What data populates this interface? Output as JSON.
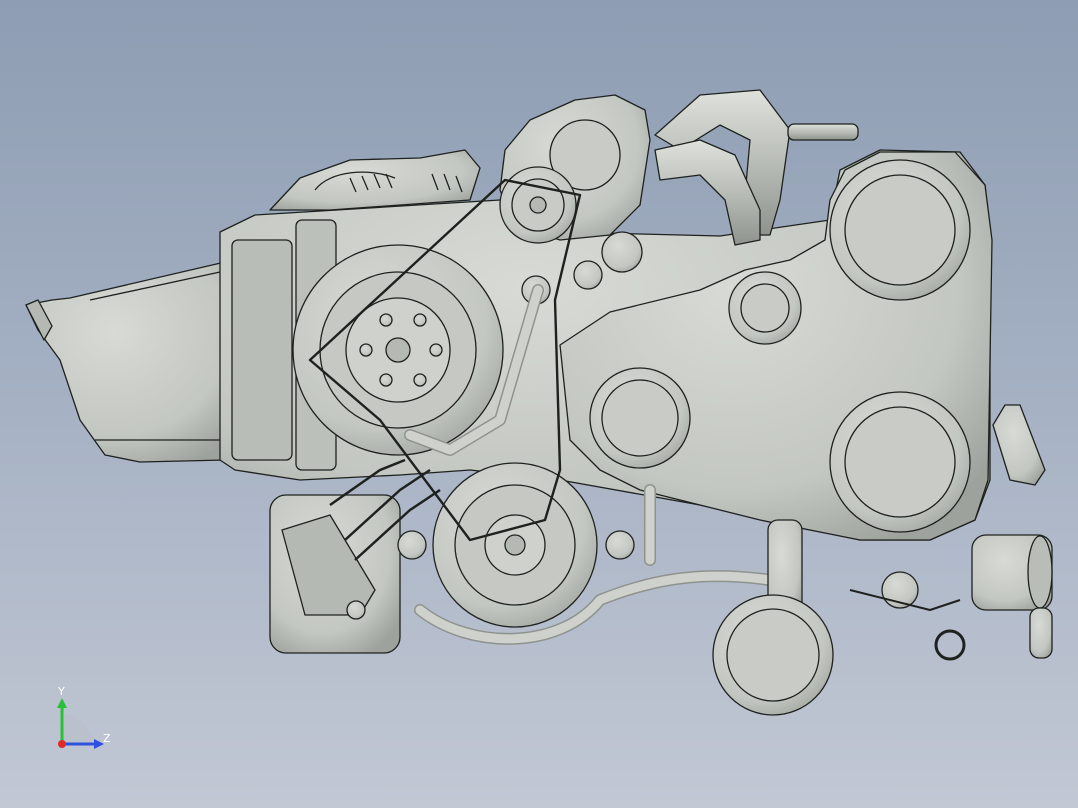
{
  "scene": {
    "background_top": "#8e9db3",
    "background_bottom": "#c2c8d4",
    "model_fill": "#c3c7c1",
    "model_shade": "#a9ada8",
    "edge_color": "#1e211e"
  },
  "triad": {
    "y_label": "Y",
    "z_label": "Z",
    "y_color": "#2bbf3a",
    "z_color": "#2f50e0",
    "x_color": "#e02a2a"
  }
}
